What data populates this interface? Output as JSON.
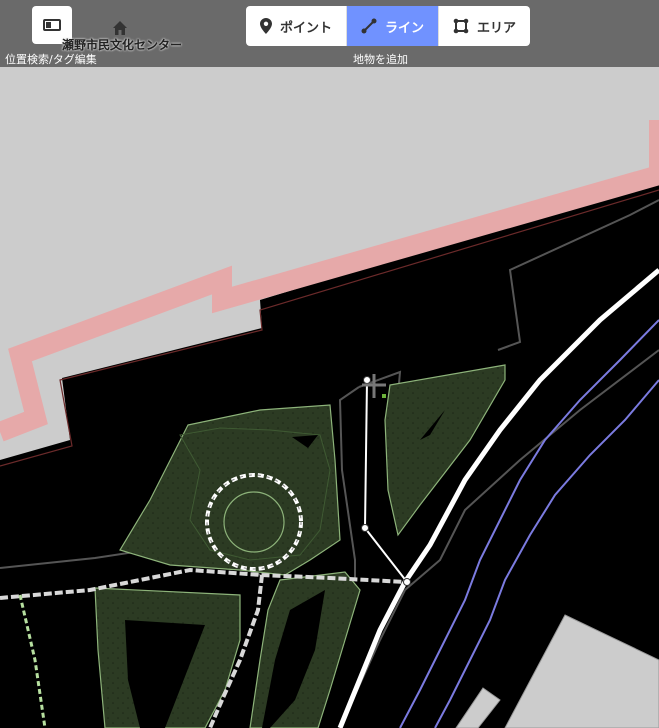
{
  "toolbar": {
    "search_caption": "位置検索/タグ編集",
    "add_feature_caption": "地物を追加",
    "modes": [
      {
        "label": "ポイント",
        "icon": "map-pin-icon",
        "active": false
      },
      {
        "label": "ライン",
        "icon": "line-icon",
        "active": true
      },
      {
        "label": "エリア",
        "icon": "area-icon",
        "active": false
      }
    ]
  },
  "map": {
    "poi_label": "瀬野市民文化センター",
    "poi_icon": "house-icon",
    "colors": {
      "background": "#000000",
      "building": "#cccccc",
      "building_outline": "#e6a9a9",
      "vegetation": "#2c3b23",
      "vegetation_outline": "#8db37a",
      "path": "#ffffff",
      "waterway": "#7b7be0",
      "toolbar": "#6a6a6a",
      "active_mode": "#7092ff"
    }
  }
}
